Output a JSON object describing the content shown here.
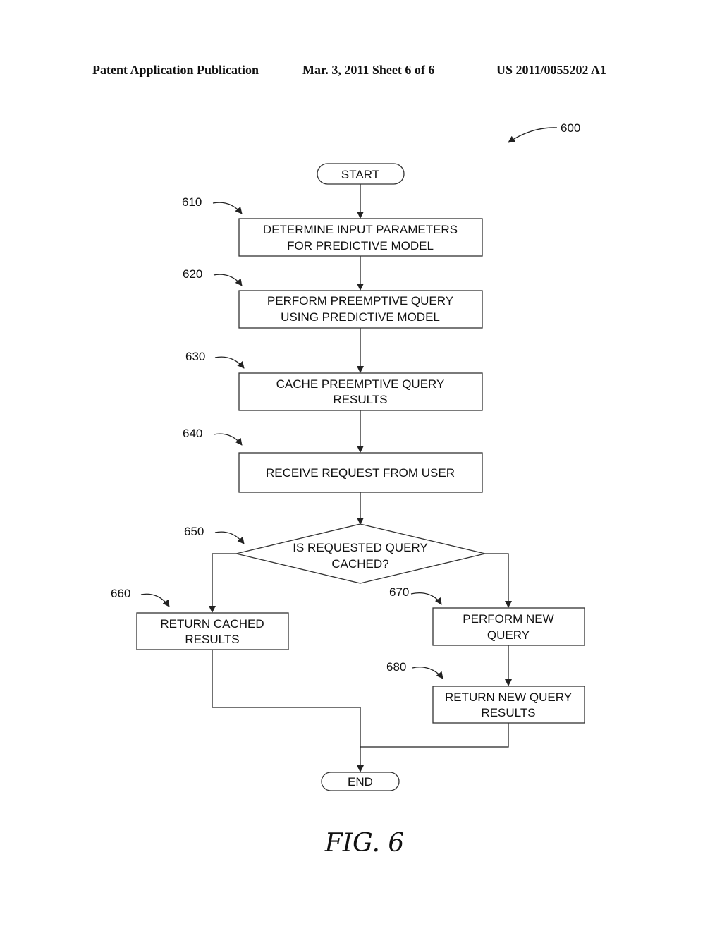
{
  "header": {
    "left": "Patent Application Publication",
    "middle": "Mar. 3, 2011   Sheet 6 of 6",
    "right": "US 2011/0055202 A1"
  },
  "figure": {
    "ref": "600",
    "caption": "FIG. 6"
  },
  "nodes": [
    {
      "id": "start",
      "type": "terminator",
      "lines": [
        "START"
      ]
    },
    {
      "id": "610",
      "type": "process",
      "ref": "610",
      "lines": [
        "DETERMINE INPUT PARAMETERS",
        "FOR PREDICTIVE MODEL"
      ]
    },
    {
      "id": "620",
      "type": "process",
      "ref": "620",
      "lines": [
        "PERFORM PREEMPTIVE QUERY",
        "USING PREDICTIVE MODEL"
      ]
    },
    {
      "id": "630",
      "type": "process",
      "ref": "630",
      "lines": [
        "CACHE PREEMPTIVE QUERY",
        "RESULTS"
      ]
    },
    {
      "id": "640",
      "type": "process",
      "ref": "640",
      "lines": [
        "RECEIVE REQUEST FROM USER"
      ]
    },
    {
      "id": "650",
      "type": "decision",
      "ref": "650",
      "lines": [
        "IS REQUESTED QUERY",
        "CACHED?"
      ]
    },
    {
      "id": "660",
      "type": "process",
      "ref": "660",
      "lines": [
        "RETURN CACHED",
        "RESULTS"
      ]
    },
    {
      "id": "670",
      "type": "process",
      "ref": "670",
      "lines": [
        "PERFORM NEW",
        "QUERY"
      ]
    },
    {
      "id": "680",
      "type": "process",
      "ref": "680",
      "lines": [
        "RETURN NEW QUERY",
        "RESULTS"
      ]
    },
    {
      "id": "end",
      "type": "terminator",
      "lines": [
        "END"
      ]
    }
  ],
  "edges": [
    {
      "from": "start",
      "to": "610"
    },
    {
      "from": "610",
      "to": "620"
    },
    {
      "from": "620",
      "to": "630"
    },
    {
      "from": "630",
      "to": "640"
    },
    {
      "from": "640",
      "to": "650"
    },
    {
      "from": "650",
      "to": "660",
      "branch": "left"
    },
    {
      "from": "650",
      "to": "670",
      "branch": "right"
    },
    {
      "from": "670",
      "to": "680"
    },
    {
      "from": "660",
      "to": "end"
    },
    {
      "from": "680",
      "to": "end"
    }
  ]
}
